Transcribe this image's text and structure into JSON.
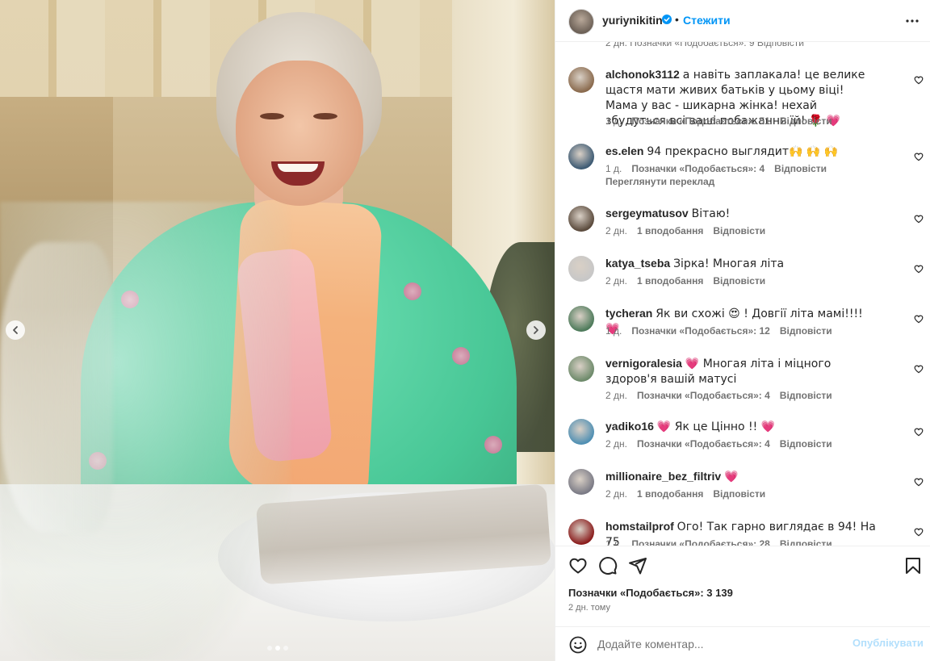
{
  "post": {
    "username": "yuriynikitin",
    "follow_label": "Стежити",
    "separator": "•"
  },
  "partial_top_meta": "2 дн.   Позначки «Подобається»: 9   Відповісти",
  "comments": [
    {
      "user": "alchonok3112",
      "text": "а навіть заплакала! це велике щастя мати живих батьків у цьому віці! Мама у вас - шикарна жінка! нехай збудуться всі ваші побажання їй! 🌹 💗",
      "time": "1 д.",
      "likes": "Позначки «Подобається»: 51",
      "reply": "Відповісти",
      "avatar_color": "#8a6a4d"
    },
    {
      "user": "es.elen",
      "text": "94 прекрасно выглядит🙌 🙌 🙌",
      "time": "1 д.",
      "likes": "Позначки «Подобається»: 4",
      "reply": "Відповісти",
      "translate": "Переглянути переклад",
      "avatar_color": "#3d5a73"
    },
    {
      "user": "sergeymatusov",
      "text": "Вітаю!",
      "time": "2 дн.",
      "likes": "1 вподобання",
      "reply": "Відповісти",
      "avatar_color": "#5a4a3c"
    },
    {
      "user": "katya_tseba",
      "text": "Зірка! Многая літа",
      "time": "2 дн.",
      "likes": "1 вподобання",
      "reply": "Відповісти",
      "avatar_color": "#c7c7c7"
    },
    {
      "user": "tycheran",
      "text": "Як ви схожі 😍 ! Довгії літа мамі!!!!💗",
      "time": "1 д.",
      "likes": "Позначки «Подобається»: 12",
      "reply": "Відповісти",
      "avatar_color": "#4d7a5a"
    },
    {
      "user": "vernigoralesia",
      "text": "💗  Многая літа і міцного здоров'я вашій матусі",
      "time": "2 дн.",
      "likes": "Позначки «Подобається»: 4",
      "reply": "Відповісти",
      "avatar_color": "#6d8a6a"
    },
    {
      "user": "yadiko16",
      "text": "💗  Як це Цінно !! 💗",
      "time": "2 дн.",
      "likes": "Позначки «Подобається»: 4",
      "reply": "Відповісти",
      "avatar_color": "#4f8fb3"
    },
    {
      "user": "millionaire_bez_filtriv",
      "text": "💗",
      "time": "2 дн.",
      "likes": "1 вподобання",
      "reply": "Відповісти",
      "avatar_color": "#7a7a85"
    },
    {
      "user": "homstailprof",
      "text": "Ого! Так гарно виглядає в 94! На 75",
      "time": "1 д.",
      "likes": "Позначки «Подобається»: 28",
      "reply": "Відповісти",
      "avatar_color": "#8a1c1c"
    }
  ],
  "likes_summary": "Позначки «Подобається»: 3 139",
  "post_time": "2 дн. тому",
  "comment_input": {
    "placeholder": "Додайте коментар...",
    "value": ""
  },
  "publish_label": "Опублікувати",
  "carousel": {
    "total_slides": 3,
    "active_slide": 2
  },
  "colors": {
    "accent": "#0095f6",
    "publish_disabled": "#b2dffc",
    "muted_text": "#737373",
    "heart": "#ed2c57"
  },
  "icons": {
    "verified": "verified-badge-icon",
    "more": "more-options-icon",
    "like": "heart-outline-icon",
    "comment": "comment-bubble-icon",
    "share": "paper-plane-icon",
    "save": "bookmark-icon",
    "emoji": "smiley-icon",
    "prev": "chevron-left-icon",
    "next": "chevron-right-icon"
  }
}
